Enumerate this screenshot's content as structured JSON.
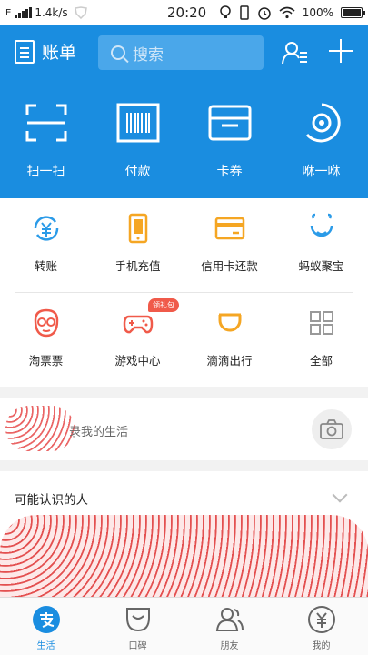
{
  "status_bar": {
    "carrier": "E",
    "speed": "1.4k/s",
    "time": "20:20",
    "battery": "100%",
    "battery_level": 1.0
  },
  "header": {
    "bill_label": "账单",
    "search_placeholder": "搜索"
  },
  "quick_actions": [
    {
      "label": "扫一扫",
      "icon": "scan-icon"
    },
    {
      "label": "付款",
      "icon": "barcode-icon"
    },
    {
      "label": "卡券",
      "icon": "card-wallet-icon"
    },
    {
      "label": "咻一咻",
      "icon": "xiu-icon"
    }
  ],
  "services": [
    {
      "label": "转账",
      "icon": "transfer-icon",
      "color": "#2b9be8"
    },
    {
      "label": "手机充值",
      "icon": "phone-topup-icon",
      "color": "#f5a623"
    },
    {
      "label": "信用卡还款",
      "icon": "credit-card-icon",
      "color": "#f5a623"
    },
    {
      "label": "蚂蚁聚宝",
      "icon": "ant-fortune-icon",
      "color": "#2b9be8"
    },
    {
      "label": "淘票票",
      "icon": "taopiaopiao-icon",
      "color": "#f05a4a"
    },
    {
      "label": "游戏中心",
      "icon": "gamepad-icon",
      "color": "#f05a4a",
      "badge": "领礼包"
    },
    {
      "label": "滴滴出行",
      "icon": "didi-icon",
      "color": "#f5a623"
    },
    {
      "label": "全部",
      "icon": "grid-all-icon",
      "color": "#999999"
    }
  ],
  "moments": {
    "prompt": "录我的生活"
  },
  "people": {
    "title": "可能认识的人"
  },
  "tabs": [
    {
      "label": "生活",
      "icon": "alipay-icon",
      "active": true
    },
    {
      "label": "口碑",
      "icon": "koubei-icon",
      "active": false
    },
    {
      "label": "朋友",
      "icon": "friends-icon",
      "active": false
    },
    {
      "label": "我的",
      "icon": "wallet-icon",
      "active": false
    }
  ],
  "colors": {
    "brand_blue": "#1a8de0",
    "search_bg": "#4aa7ea"
  }
}
